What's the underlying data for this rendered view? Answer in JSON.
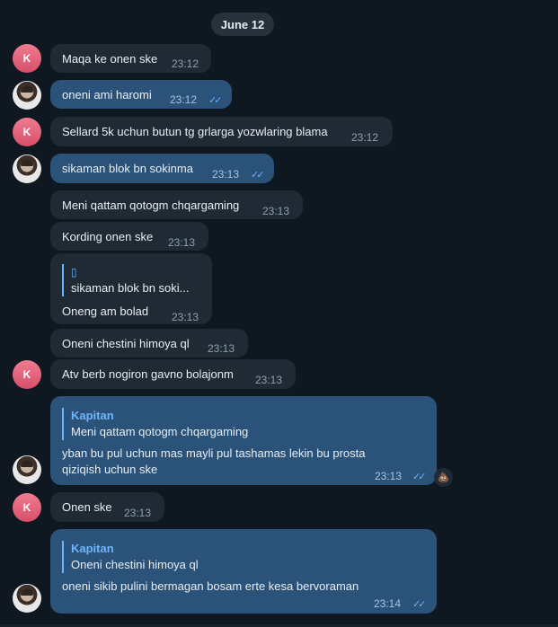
{
  "date": "June 12",
  "avatars": {
    "k_letter": "K"
  },
  "messages": [
    {
      "text": "Maqa ke onen ske",
      "time": "23:12"
    },
    {
      "text": "oneni ami haromi",
      "time": "23:12"
    },
    {
      "text": "Sellard 5k uchun butun tg grlarga yozwlaring blama",
      "time": "23:12"
    },
    {
      "text": "sikaman blok bn sokinma",
      "time": "23:13"
    },
    {
      "text": "Meni qattam qotogm chqargaming",
      "time": "23:13"
    },
    {
      "text": "Kording onen ske",
      "time": "23:13"
    },
    {
      "quote_icon": "▯",
      "quote_text": "sikaman blok bn soki...",
      "text": "Oneng am bolad",
      "time": "23:13"
    },
    {
      "text": "Oneni chestini himoya ql",
      "time": "23:13"
    },
    {
      "text": "Atv berb nogiron gavno bolajonm",
      "time": "23:13"
    },
    {
      "quote_author": "Kapitan",
      "quote_text": "Meni qattam qotogm chqargaming",
      "line1": "yban bu pul uchun mas mayli pul tashamas lekin bu prosta",
      "line2": "qiziqish uchun ske",
      "time": "23:13"
    },
    {
      "text": "Onen ske",
      "time": "23:13"
    },
    {
      "quote_author": "Kapitan",
      "quote_text": "Oneni chestini himoya ql",
      "text": "oneni sikib pulini bermagan bosam erte kesa bervoraman",
      "time": "23:14"
    }
  ],
  "reaction_emoji": "💩",
  "ticks": "✓✓"
}
